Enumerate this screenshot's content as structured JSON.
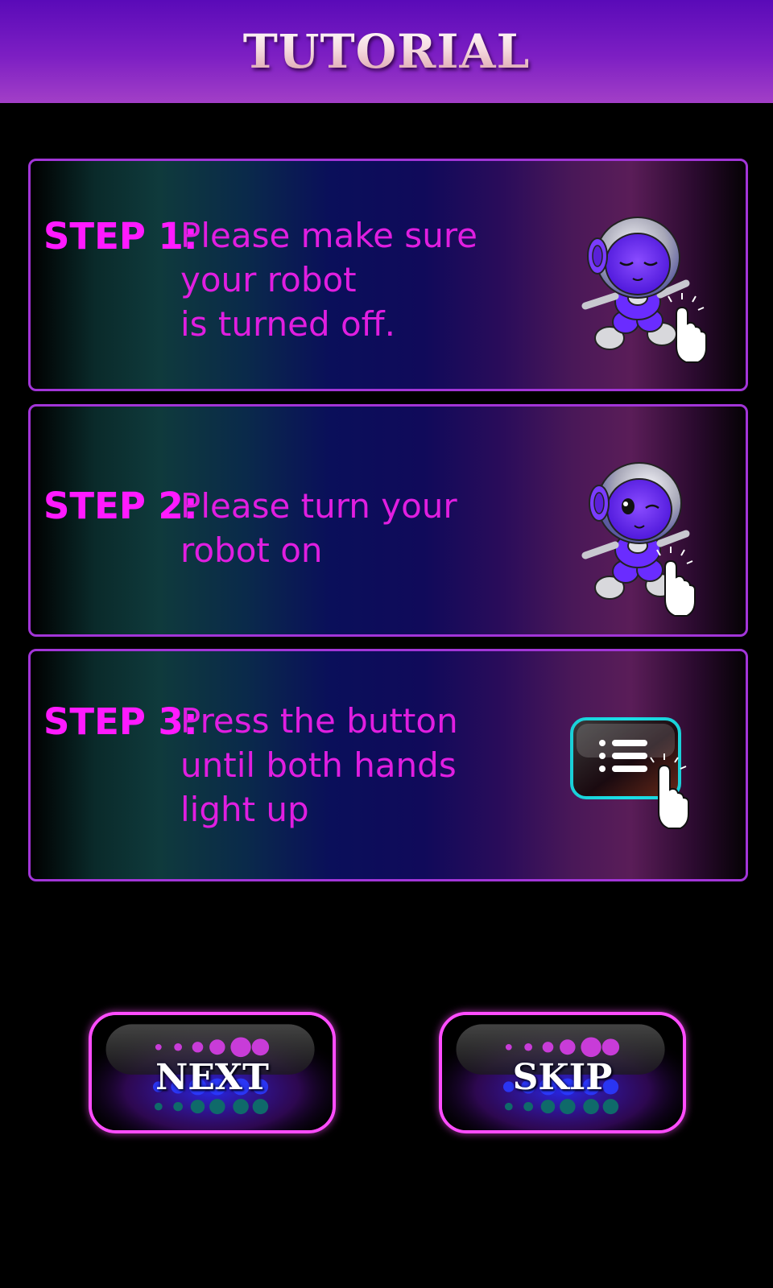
{
  "header": {
    "title": "TUTORIAL"
  },
  "steps": [
    {
      "label": "STEP 1:",
      "text": "Please make sure\nyour robot\nis turned off.",
      "illustration": "robot-sleeping-with-tap-hand"
    },
    {
      "label": "STEP 2:",
      "text": "Please turn your\nrobot on",
      "illustration": "robot-winking-with-tap-hand"
    },
    {
      "label": "STEP 3:",
      "text": "Press the button\nuntil both hands\nlight up",
      "illustration": "list-button-with-tap-hand"
    }
  ],
  "buttons": {
    "next_label": "NEXT",
    "skip_label": "SKIP"
  },
  "colors": {
    "accent_magenta": "#ff1aff",
    "step_text": "#e01ee0",
    "card_border": "#a235d8",
    "button_border": "#ff4cff",
    "header_top": "#5a0ab8",
    "header_bottom": "#a23fc7"
  }
}
